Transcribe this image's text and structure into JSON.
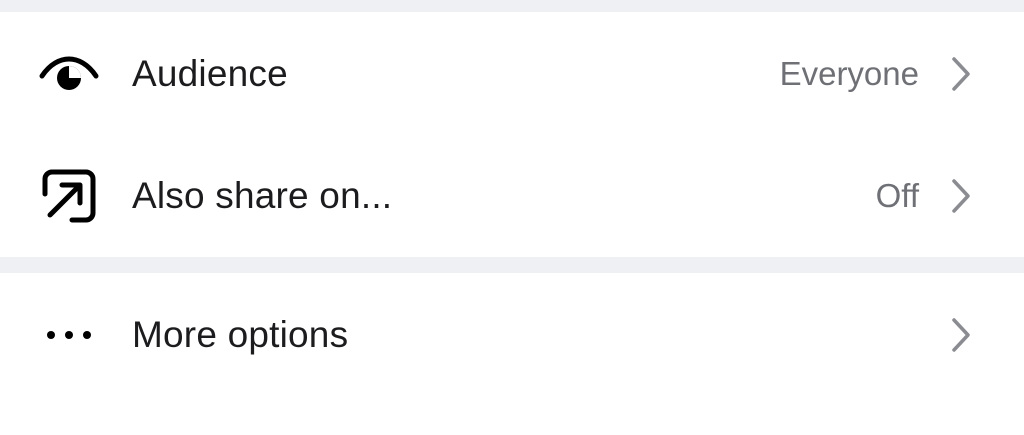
{
  "settings": {
    "section1": [
      {
        "label": "Audience",
        "value": "Everyone",
        "icon": "eye-icon"
      },
      {
        "label": "Also share on...",
        "value": "Off",
        "icon": "share-arrow-icon"
      }
    ],
    "section2": [
      {
        "label": "More options",
        "value": "",
        "icon": "more-dots-icon"
      }
    ]
  },
  "colors": {
    "background": "#ffffff",
    "separator": "#eef0f3",
    "label": "#1c1c1e",
    "secondary": "#6e7076",
    "chevron": "#8a8c91"
  }
}
